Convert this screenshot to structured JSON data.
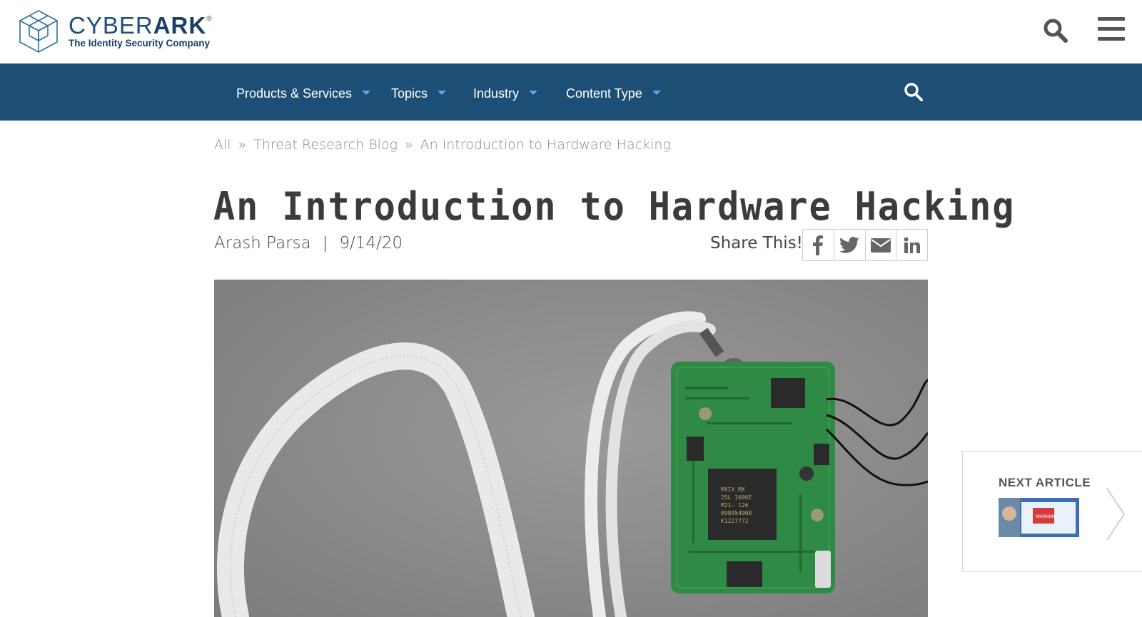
{
  "header": {
    "logo_word_light": "CYBER",
    "logo_word_bold": "ARK",
    "logo_registered": "®",
    "logo_tagline": "The Identity Security Company",
    "search_icon": "search-icon",
    "menu_icon": "hamburger-menu-icon"
  },
  "nav": {
    "items": [
      {
        "label": "Products & Services"
      },
      {
        "label": "Topics"
      },
      {
        "label": "Industry"
      },
      {
        "label": "Content Type"
      }
    ],
    "search_icon": "search-icon"
  },
  "breadcrumb": {
    "items": [
      "All",
      "Threat Research Blog",
      "An Introduction to Hardware Hacking"
    ],
    "separator": "»"
  },
  "article": {
    "title": "An Introduction to Hardware Hacking",
    "author": "Arash Parsa",
    "separator": "|",
    "date": "9/14/20",
    "share_label": "Share This!",
    "share_buttons": [
      "facebook-icon",
      "twitter-icon",
      "email-icon",
      "linkedin-icon"
    ],
    "chip_text": [
      "MXIX MX",
      "25L 1606E",
      "M21- 126",
      "098454900",
      "K1227772"
    ]
  },
  "next_article": {
    "label": "NEXT ARTICLE",
    "thumb_text": "WARNING"
  },
  "colors": {
    "nav_bg": "#1d4e75",
    "brand_blue": "#1a3f68",
    "caret_blue": "#5fa8de",
    "text_dark": "#3b3b3b",
    "pcb_green": "#2f8a45"
  }
}
